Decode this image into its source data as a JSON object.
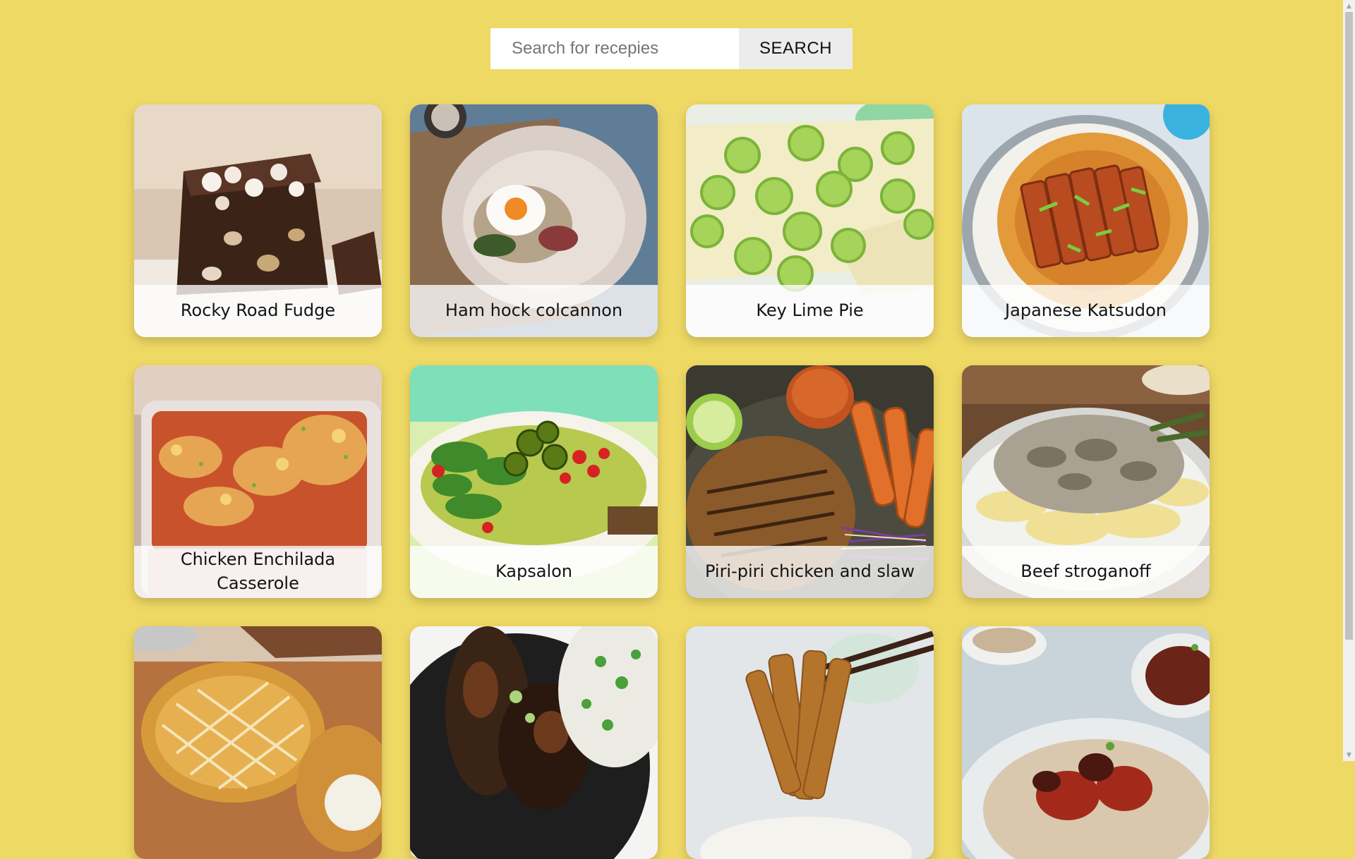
{
  "search": {
    "placeholder": "Search for recepies",
    "value": "",
    "button_label": "SEARCH"
  },
  "recipes": [
    {
      "title": "Rocky Road Fudge"
    },
    {
      "title": "Ham hock colcannon"
    },
    {
      "title": "Key Lime Pie"
    },
    {
      "title": "Japanese Katsudon"
    },
    {
      "title": "Chicken Enchilada Casserole"
    },
    {
      "title": "Kapsalon"
    },
    {
      "title": "Piri-piri chicken and slaw"
    },
    {
      "title": "Beef stroganoff"
    },
    {
      "title": ""
    },
    {
      "title": ""
    },
    {
      "title": ""
    },
    {
      "title": ""
    }
  ],
  "colors": {
    "background": "#efd965",
    "card_label_overlay": "#ffffff",
    "search_button": "#ececec"
  },
  "icons": {
    "scroll_up": "scroll-up-arrow-icon",
    "scroll_down": "scroll-down-arrow-icon"
  }
}
